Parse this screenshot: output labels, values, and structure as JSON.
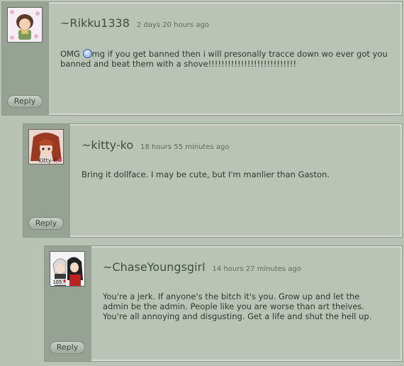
{
  "comments": [
    {
      "username": "~Rikku1338",
      "time": "2 days 20 hours ago",
      "text_before_emote": "OMG ",
      "text_after_emote": "mg if you get banned then i will presonally tracce down wo ever got you banned and beat them with a shove!!!!!!!!!!!!!!!!!!!!!!!!!!!",
      "reply": "Reply",
      "avatar_icon": "anime-girl-avatar"
    },
    {
      "username": "~kitty-ko",
      "time": "18 hours 55 minutes ago",
      "text": "Bring it dollface. I may be cute, but I'm manlier than Gaston.",
      "reply": "Reply",
      "avatar_icon": "red-hair-anime-avatar",
      "avatar_label": "Kitty-K"
    },
    {
      "username": "~ChaseYoungsgirl",
      "time": "14 hours 27 minutes ago",
      "text": "You're a jerk. If anyone's the bitch it's you. Grow up and let the admin be the admin. People like you are worse than art theives. You're all annoying and disgusting. Get a life and shut the hell up.",
      "reply": "Reply",
      "avatar_icon": "anime-couple-avatar",
      "avatar_label": "105"
    }
  ],
  "colors": {
    "background": "#b8c3b6",
    "sidebar": "#96a394",
    "username": "#3e4f3d"
  }
}
